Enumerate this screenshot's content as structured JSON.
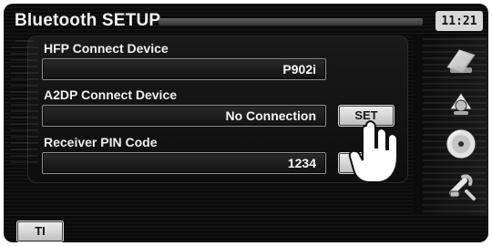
{
  "header": {
    "title": "Bluetooth SETUP",
    "time": "11:21"
  },
  "settings": {
    "hfp": {
      "label": "HFP Connect Device",
      "value": "P902i"
    },
    "a2dp": {
      "label": "A2DP Connect Device",
      "value": "No Connection",
      "button_label": "SET"
    },
    "pin": {
      "label": "Receiver PIN Code",
      "value": "1234",
      "button_label": "SET"
    }
  },
  "footer": {
    "ti_label": "TI"
  },
  "side_icons": [
    "navigation-icon",
    "audio-icon",
    "disc-icon",
    "setup-icon"
  ]
}
